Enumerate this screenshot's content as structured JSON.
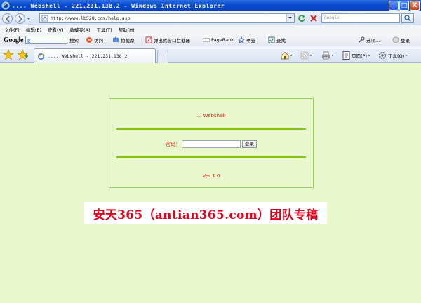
{
  "window": {
    "title": ".... Webshell - 221.231.138.2 - Windows Internet Explorer",
    "controls": [
      "_",
      "□",
      "X"
    ]
  },
  "address_bar": {
    "url": "http://www.lb528.com/help.asp",
    "search_placeholder": "Google"
  },
  "menu": {
    "items": [
      "文件(F)",
      "编辑(E)",
      "查看(V)",
      "收藏夹(A)",
      "工具(T)",
      "帮助(H)"
    ]
  },
  "google_toolbar": {
    "logo": "Google",
    "search_label": "搜索",
    "sidewiki_label": "访问",
    "bookmarks_label": "拍截摩",
    "popup_blocker_label": "弹出式窗口拦截器",
    "pagerank_label": "PageRank",
    "bookmark_label": "书签",
    "check_label": "查找",
    "options_label": "选项...",
    "login_label": "登录"
  },
  "tabs": {
    "active_label": ".... Webshell - 221.231.138.2",
    "page_menu_label": "页面(P)",
    "tools_menu_label": "工具(O)"
  },
  "page": {
    "panel_title": "... Webshell",
    "password_label": "密码：",
    "password_value": "",
    "submit_label": "登录",
    "version": "Ver 1.0",
    "watermark": "安天365（antian365.com）团队专稿"
  },
  "colors": {
    "title_bar": "#0a4ed2",
    "content_background": "#e8f7cc",
    "panel_border": "#9bcf6a",
    "separator": "#7fc81c",
    "page_text": "#e0241a",
    "watermark_text": "#e0001b"
  }
}
